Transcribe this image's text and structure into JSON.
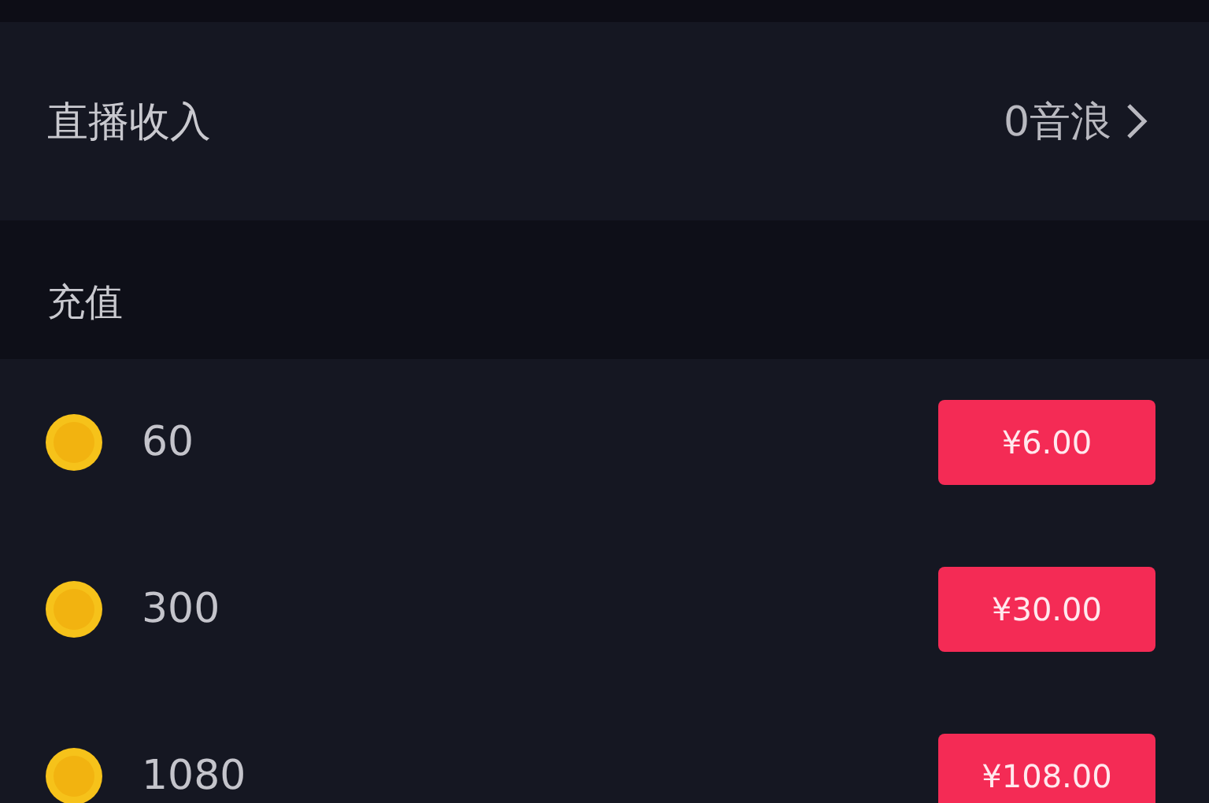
{
  "income": {
    "label": "直播收入",
    "value": "0音浪"
  },
  "recharge": {
    "title": "充值",
    "options": [
      {
        "amount": "60",
        "price": "¥6.00"
      },
      {
        "amount": "300",
        "price": "¥30.00"
      },
      {
        "amount": "1080",
        "price": "¥108.00"
      }
    ]
  }
}
